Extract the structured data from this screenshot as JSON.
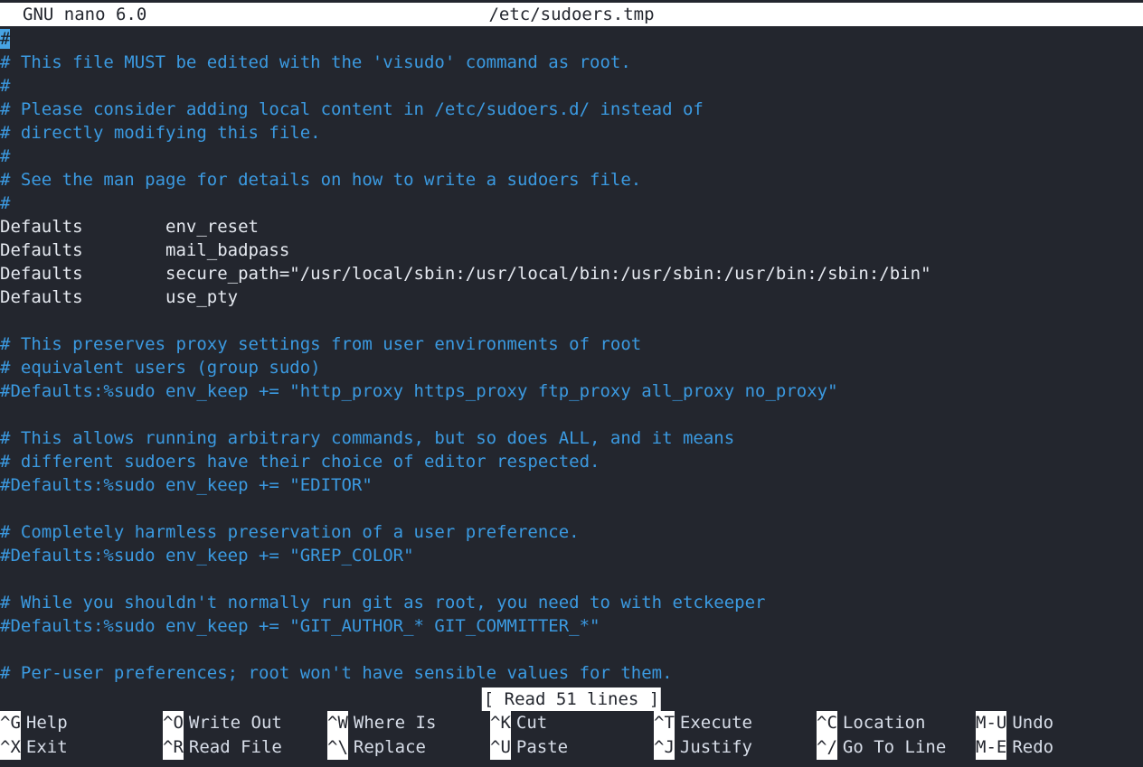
{
  "titlebar": {
    "version": "GNU nano 6.0",
    "filename": "/etc/sudoers.tmp"
  },
  "editor": {
    "cursor_char": "#",
    "lines": [
      {
        "kind": "comment",
        "text": "",
        "cursor": true
      },
      {
        "kind": "comment",
        "text": "# This file MUST be edited with the 'visudo' command as root."
      },
      {
        "kind": "comment",
        "text": "#"
      },
      {
        "kind": "comment",
        "text": "# Please consider adding local content in /etc/sudoers.d/ instead of"
      },
      {
        "kind": "comment",
        "text": "# directly modifying this file."
      },
      {
        "kind": "comment",
        "text": "#"
      },
      {
        "kind": "comment",
        "text": "# See the man page for details on how to write a sudoers file."
      },
      {
        "kind": "comment",
        "text": "#"
      },
      {
        "kind": "plain",
        "text": "Defaults        env_reset"
      },
      {
        "kind": "plain",
        "text": "Defaults        mail_badpass"
      },
      {
        "kind": "plain",
        "text": "Defaults        secure_path=\"/usr/local/sbin:/usr/local/bin:/usr/sbin:/usr/bin:/sbin:/bin\""
      },
      {
        "kind": "plain",
        "text": "Defaults        use_pty"
      },
      {
        "kind": "blank",
        "text": ""
      },
      {
        "kind": "comment",
        "text": "# This preserves proxy settings from user environments of root"
      },
      {
        "kind": "comment",
        "text": "# equivalent users (group sudo)"
      },
      {
        "kind": "comment",
        "text": "#Defaults:%sudo env_keep += \"http_proxy https_proxy ftp_proxy all_proxy no_proxy\""
      },
      {
        "kind": "blank",
        "text": ""
      },
      {
        "kind": "comment",
        "text": "# This allows running arbitrary commands, but so does ALL, and it means"
      },
      {
        "kind": "comment",
        "text": "# different sudoers have their choice of editor respected."
      },
      {
        "kind": "comment",
        "text": "#Defaults:%sudo env_keep += \"EDITOR\""
      },
      {
        "kind": "blank",
        "text": ""
      },
      {
        "kind": "comment",
        "text": "# Completely harmless preservation of a user preference."
      },
      {
        "kind": "comment",
        "text": "#Defaults:%sudo env_keep += \"GREP_COLOR\""
      },
      {
        "kind": "blank",
        "text": ""
      },
      {
        "kind": "comment",
        "text": "# While you shouldn't normally run git as root, you need to with etckeeper"
      },
      {
        "kind": "comment",
        "text": "#Defaults:%sudo env_keep += \"GIT_AUTHOR_* GIT_COMMITTER_*\""
      },
      {
        "kind": "blank",
        "text": ""
      },
      {
        "kind": "comment",
        "text": "# Per-user preferences; root won't have sensible values for them."
      }
    ]
  },
  "status": {
    "message": "[ Read 51 lines ]"
  },
  "shortcuts": {
    "row1": [
      {
        "key": "^G",
        "label": "Help",
        "col": 0
      },
      {
        "key": "^O",
        "label": "Write Out",
        "col": 180
      },
      {
        "key": "^W",
        "label": "Where Is",
        "col": 362
      },
      {
        "key": "^K",
        "label": "Cut",
        "col": 542
      },
      {
        "key": "^T",
        "label": "Execute",
        "col": 723
      },
      {
        "key": "^C",
        "label": "Location",
        "col": 903
      },
      {
        "key": "M-U",
        "label": "Undo",
        "col": 1079
      }
    ],
    "row2": [
      {
        "key": "^X",
        "label": "Exit",
        "col": 0
      },
      {
        "key": "^R",
        "label": "Read File",
        "col": 180
      },
      {
        "key": "^\\",
        "label": "Replace",
        "col": 362
      },
      {
        "key": "^U",
        "label": "Paste",
        "col": 542
      },
      {
        "key": "^J",
        "label": "Justify",
        "col": 723
      },
      {
        "key": "^/",
        "label": "Go To Line",
        "col": 903
      },
      {
        "key": "M-E",
        "label": "Redo",
        "col": 1079
      }
    ]
  },
  "colors": {
    "background": "#23262e",
    "comment": "#3b9ae1",
    "text": "#e5e9f0",
    "inverse_bg": "#ffffff",
    "inverse_fg": "#23262e",
    "cursor_bg": "#47a3e3"
  }
}
